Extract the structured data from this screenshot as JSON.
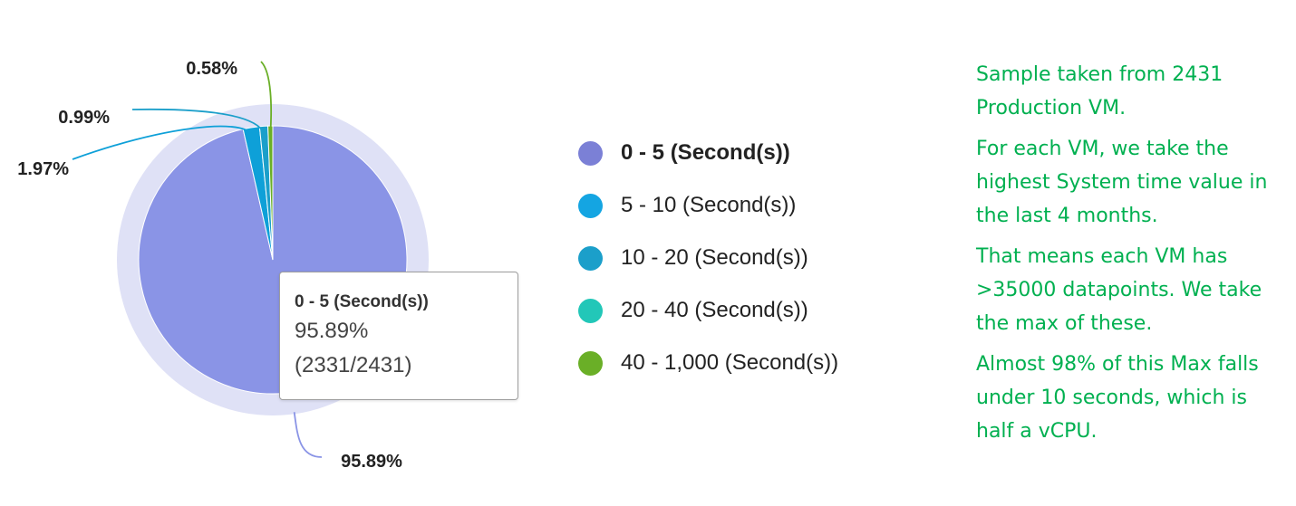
{
  "chart_data": {
    "type": "pie",
    "categories": [
      "0 - 5 (Second(s))",
      "5 - 10 (Second(s))",
      "10 - 20 (Second(s))",
      "20 - 40 (Second(s))",
      "40 - 1,000 (Second(s))"
    ],
    "values": [
      95.89,
      1.97,
      0.99,
      0.0,
      0.58
    ],
    "percent_labels": [
      "95.89%",
      "1.97%",
      "0.99%",
      "",
      "0.58%"
    ],
    "colors": [
      "#8a94e6",
      "#0ea0d8",
      "#1b9fca",
      "#22c7b8",
      "#6aaf27"
    ],
    "legend_position": "right",
    "highlighted_index": 0
  },
  "legend": [
    {
      "label": "0 - 5 (Second(s))",
      "color": "#7b80d6"
    },
    {
      "label": "5 - 10 (Second(s))",
      "color": "#14a5e2"
    },
    {
      "label": "10 - 20 (Second(s))",
      "color": "#1b9fca"
    },
    {
      "label": "20 - 40 (Second(s))",
      "color": "#22c7b8"
    },
    {
      "label": "40 - 1,000 (Second(s))",
      "color": "#6aaf27"
    }
  ],
  "tooltip": {
    "title": "0 - 5 (Second(s))",
    "percent": "95.89%",
    "count": "(2331/2431)"
  },
  "notes": [
    "Sample taken from 2431 Production VM.",
    "For each VM, we take the highest System time value in the last 4 months.",
    "That means each VM has >35000 datapoints. We take the max of these.",
    "Almost 98% of this Max falls under 10 seconds, which is half a vCPU."
  ]
}
